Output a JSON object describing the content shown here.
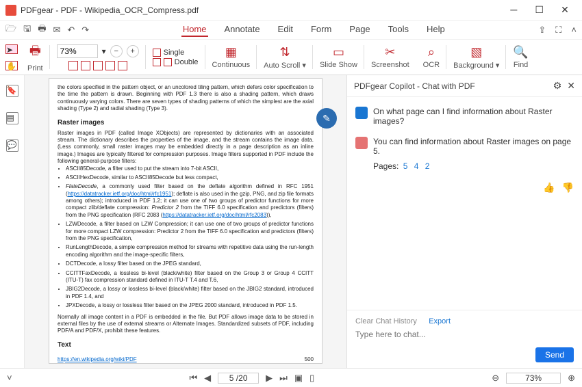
{
  "title": "PDFgear - PDF - Wikipedia_OCR_Compress.pdf",
  "tabs": [
    "Home",
    "Annotate",
    "Edit",
    "Form",
    "Page",
    "Tools",
    "Help"
  ],
  "active_tab": 0,
  "ribbon": {
    "print": "Print",
    "zoom": "73%",
    "single": "Single",
    "double": "Double",
    "continuous": "Continuous",
    "autoscroll": "Auto Scroll",
    "slideshow": "Slide Show",
    "screenshot": "Screenshot",
    "ocr": "OCR",
    "background": "Background",
    "find": "Find"
  },
  "page": {
    "intro": "the colors specified in the pattern object, or an uncolored tiling pattern, which defers color specification to the time the pattern is drawn. Beginning with PDF 1.3 there is also a shading pattern, which draws continuously varying colors. There are seven types of shading patterns of which the simplest are the axial shading (Type 2) and radial shading (Type 3).",
    "raster_title": "Raster images",
    "raster_body": "Raster images in PDF (called Image XObjects) are represented by dictionaries with an associated stream. The dictionary describes the properties of the image, and the stream contains the image data. (Less commonly, small raster images may be embedded directly in a page description as an inline image.) Images are typically filtered for compression purposes. Image filters supported in PDF include the following general-purpose filters:",
    "bullets": [
      "ASCII85Decode, a filter used to put the stream into 7-bit ASCII,",
      "ASCIIHexDecode, similar to ASCII85Decode but less compact,",
      "FlateDecode, a commonly used filter based on the deflate algorithm defined in RFC 1951 (https://datatracker.ietf.org/doc/html/rfc1951); deflate is also used in the gzip, PNG, and zip file formats among others); introduced in PDF 1.2; it can use one of two groups of predictor functions for more compact zlib/deflate compression: Predictor 2 from the TIFF 6.0 specification and predictors (filters) from the PNG specification (RFC 2083 (https://datatracker.ietf.org/doc/html/rfc2083)),",
      "LZWDecode, a filter based on LZW Compression; it can use one of two groups of predictor functions for more compact LZW compression: Predictor 2 from the TIFF 6.0 specification and predictors (filters) from the PNG specification,",
      "RunLengthDecode, a simple compression method for streams with repetitive data using the run-length encoding algorithm and the image-specific filters,",
      "DCTDecode, a lossy filter based on the JPEG standard,",
      "CCITTFaxDecode, a lossless bi-level (black/white) filter based on the Group 3 or Group 4 CCITT (ITU-T) fax compression standard defined in ITU-T T.4 and T.6,",
      "JBIG2Decode, a lossy or lossless bi-level (black/white) filter based on the JBIG2 standard, introduced in PDF 1.4, and",
      "JPXDecode, a lossy or lossless filter based on the JPEG 2000 standard, introduced in PDF 1.5."
    ],
    "outro": "Normally all image content in a PDF is embedded in the file. But PDF allows image data to be stored in external files by the use of external streams or Alternate Images. Standardized subsets of PDF, including PDF/A and PDF/X, prohibit these features.",
    "text_title": "Text",
    "source_link": "https://en.wikipedia.org/wiki/PDF",
    "page_no": "500"
  },
  "copilot": {
    "title": "PDFgear Copilot - Chat with PDF",
    "user_msg": "On what page can I find information about Raster images?",
    "bot_msg": "You can find information about Raster images on page 5.",
    "pages_label": "Pages:",
    "pages": [
      "5",
      "4",
      "2"
    ],
    "clear": "Clear Chat History",
    "export": "Export",
    "placeholder": "Type here to chat...",
    "send": "Send"
  },
  "status": {
    "page": "5 /20",
    "zoom": "73%"
  }
}
